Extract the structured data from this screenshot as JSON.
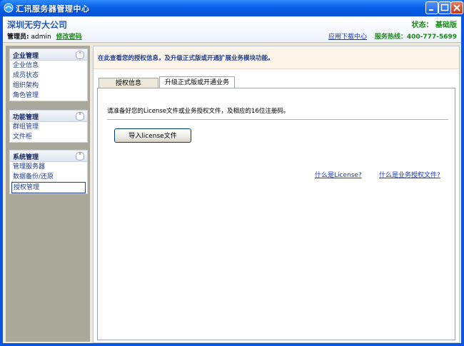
{
  "window": {
    "title": "汇讯服务器管理中心"
  },
  "header": {
    "company": "深圳无穷大公司",
    "admin_label": "管理员:",
    "admin_name": "admin",
    "change_password": "修改密码",
    "status": "状态：  基础版",
    "download_center": "应用下载中心",
    "hotline": "服务热线：400-777-5699"
  },
  "sidebar": {
    "groups": [
      {
        "title": "企业管理",
        "items": [
          "企业信息",
          "成员状态",
          "组织架构",
          "角色管理"
        ]
      },
      {
        "title": "功能管理",
        "items": [
          "群组管理",
          "文件柜"
        ]
      },
      {
        "title": "系统管理",
        "items": [
          "管理服务器",
          "数据备份/还原",
          "授权管理"
        ]
      }
    ],
    "active_item": "授权管理"
  },
  "main": {
    "notice": "在此查看您的授权信息，及升级正式版或开通扩展业务模块功能。",
    "tabs": [
      "授权信息",
      "升级正式版或开通业务"
    ],
    "active_tab": "升级正式版或开通业务",
    "instruction": "请准备好您的License文件或业务授权文件，及相应的16位注册码。",
    "import_button": "导入license文件",
    "help_link_1": "什么是License?",
    "help_link_2": "什么是业务授权文件?"
  },
  "colors": {
    "titlebar": "#0a5fe8",
    "accent_green": "#1a8a1a",
    "link_blue": "#1a37c6",
    "company_blue": "#2756b8"
  }
}
